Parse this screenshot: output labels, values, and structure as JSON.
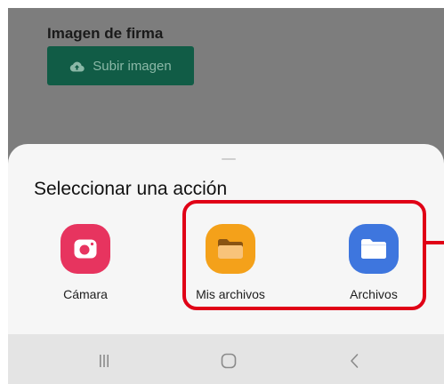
{
  "background": {
    "section_title": "Imagen de firma",
    "upload_button_label": "Subir imagen",
    "upload_icon": "cloud-upload-icon"
  },
  "sheet": {
    "title": "Seleccionar una acción",
    "apps": [
      {
        "label": "Cámara",
        "icon": "camera-icon",
        "color": "#e7345f"
      },
      {
        "label": "Mis archivos",
        "icon": "folder-icon",
        "color": "#f4a11a"
      },
      {
        "label": "Archivos",
        "icon": "folder-icon",
        "color": "#3e76de"
      }
    ]
  },
  "annotation": {
    "highlight_color": "#e00016"
  },
  "navbar": {
    "buttons": [
      {
        "icon": "recents-icon"
      },
      {
        "icon": "home-icon"
      },
      {
        "icon": "back-icon"
      }
    ]
  }
}
